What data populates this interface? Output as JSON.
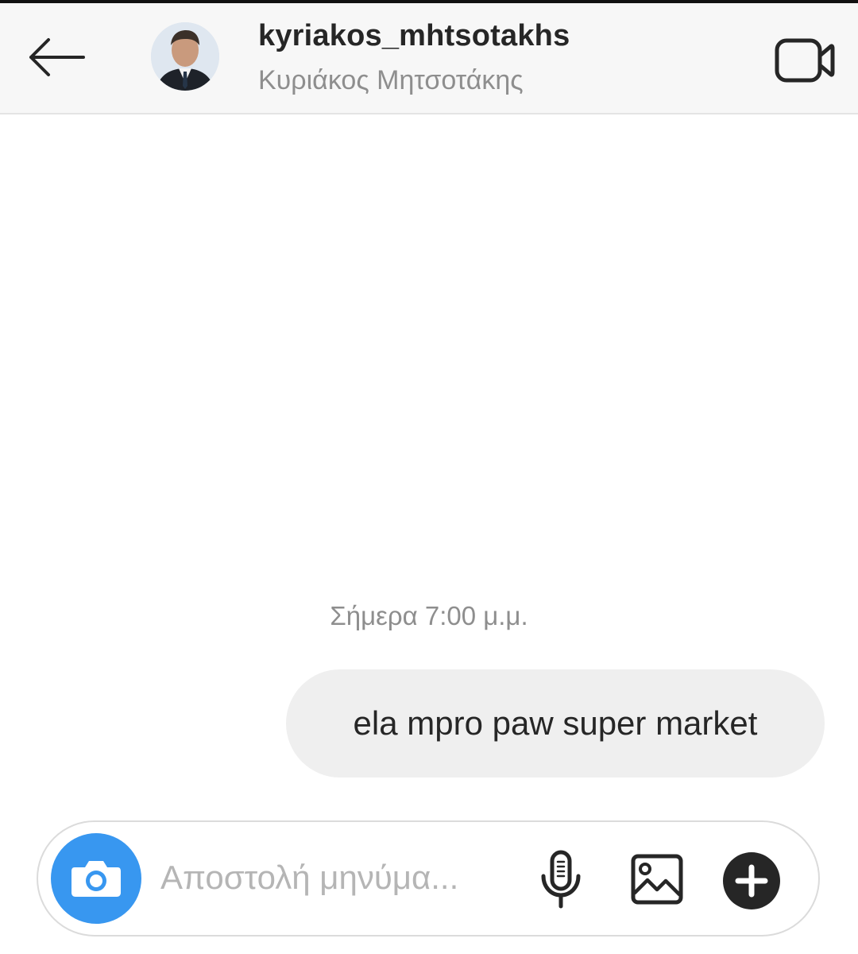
{
  "header": {
    "username": "kyriakos_mhtsotakhs",
    "full_name": "Κυριάκος Μητσοτάκης",
    "back_icon": "arrow-left-icon",
    "video_icon": "video-camera-icon"
  },
  "thread": {
    "timestamp": "Σήμερα 7:00 μ.μ.",
    "messages": [
      {
        "text": "ela mpro paw super market",
        "sender": "me"
      }
    ]
  },
  "composer": {
    "placeholder": "Αποστολή μηνύμα...",
    "camera_icon": "camera-icon",
    "mic_icon": "microphone-icon",
    "gallery_icon": "image-icon",
    "plus_icon": "plus-circle-icon"
  },
  "colors": {
    "accent": "#3897f0",
    "bubble": "#efefef",
    "header_bg": "#f7f7f7",
    "secondary_text": "#8e8e8e"
  }
}
